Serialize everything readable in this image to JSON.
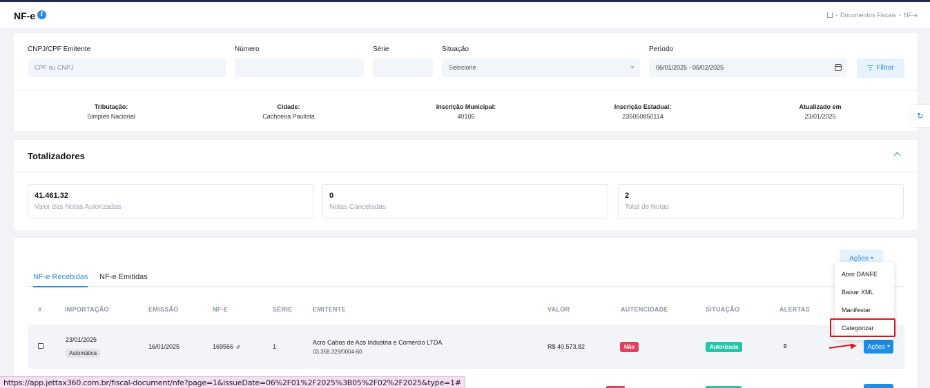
{
  "header": {
    "title": "NF-e",
    "breadcrumb": [
      "Documentos Fiscais",
      "NF-e"
    ]
  },
  "filters": {
    "cnpj_label": "CNPJ/CPF Emitente",
    "cnpj_placeholder": "CPF ou CNPJ",
    "numero_label": "Número",
    "serie_label": "Série",
    "situacao_label": "Situação",
    "situacao_value": "Selecione",
    "periodo_label": "Período",
    "periodo_value": "06/01/2025 - 05/02/2025",
    "filter_button": "Filtrar"
  },
  "company_info": {
    "tributacao_label": "Tributação:",
    "tributacao_value": "Simples Nacional",
    "cidade_label": "Cidade:",
    "cidade_value": "Cachoeira Paulista",
    "im_label": "Inscrição Municipal:",
    "im_value": "40105",
    "ie_label": "Inscrição Estadual:",
    "ie_value": "235050850114",
    "atualizado_label": "Atualizado em",
    "atualizado_value": "23/01/2025"
  },
  "totals": {
    "title": "Totalizadores",
    "items": [
      {
        "value": "41.461,32",
        "label": "Valor das Notas Autorizadas"
      },
      {
        "value": "0",
        "label": "Notas Canceladas"
      },
      {
        "value": "2",
        "label": "Total de Notas"
      }
    ]
  },
  "list": {
    "acoes_button": "Ações",
    "tabs": [
      "NF-e Recebidas",
      "NF-e Emitidas"
    ],
    "columns": [
      "#",
      "IMPORTAÇÃO",
      "EMISSÃO",
      "NF-E",
      "SÉRIE",
      "EMITENTE",
      "VALOR",
      "AUTENCIDADE",
      "SITUAÇÃO",
      "ALERTAS"
    ],
    "rows": [
      {
        "importacao": "23/01/2025",
        "tipo": "Automática",
        "emissao": "16/01/2025",
        "nfe": "169566",
        "serie": "1",
        "emitente": "Acro Cabos de Aco Industria e Comercio LTDA",
        "cnpj": "03.358.329/0004-60",
        "valor": "R$ 40.573,82",
        "autenticidade": "Não",
        "situacao": "Autorizada",
        "alertas": "0",
        "acoes": "Ações"
      }
    ]
  },
  "dropdown": {
    "items": [
      "Abrir DANFE",
      "Baixar XML",
      "Manifestar",
      "Categorizar"
    ]
  },
  "statusbar": {
    "url": "https://app.jettax360.com.br/fiscal-document/nfe?page=1&issueDate=06%2F01%2F2025%3B05%2F02%2F2025&type=1#"
  },
  "colors": {
    "accent": "#2b8bea",
    "danger": "#e0405e",
    "success": "#22c5a8",
    "highlight": "#e0111b"
  }
}
